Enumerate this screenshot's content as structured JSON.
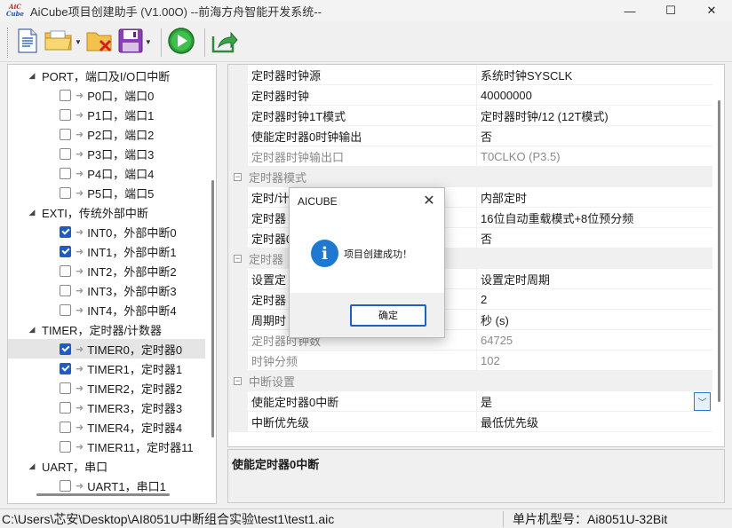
{
  "window": {
    "logo_top": "AiC",
    "logo_bottom": "Cube",
    "title": "AiCube项目创建助手 (V1.00O) --前海方舟智能开发系统--",
    "minimize_glyph": "—",
    "maximize_glyph": "☐",
    "close_glyph": "✕"
  },
  "toolbar": {
    "icons": [
      "new-document-icon",
      "open-folder-icon",
      "delete-folder-icon",
      "save-icon",
      "run-icon",
      "export-icon"
    ],
    "dropdown_glyph": "▼"
  },
  "tree": {
    "items": [
      {
        "type": "group",
        "label": "PORT，端口及I/O口中断"
      },
      {
        "type": "leaf",
        "label": "P0口，端口0",
        "checked": false
      },
      {
        "type": "leaf",
        "label": "P1口，端口1",
        "checked": false
      },
      {
        "type": "leaf",
        "label": "P2口，端口2",
        "checked": false
      },
      {
        "type": "leaf",
        "label": "P3口，端口3",
        "checked": false
      },
      {
        "type": "leaf",
        "label": "P4口，端口4",
        "checked": false
      },
      {
        "type": "leaf",
        "label": "P5口，端口5",
        "checked": false
      },
      {
        "type": "group",
        "label": "EXTI，传统外部中断"
      },
      {
        "type": "leaf",
        "label": "INT0，外部中断0",
        "checked": true
      },
      {
        "type": "leaf",
        "label": "INT1，外部中断1",
        "checked": true
      },
      {
        "type": "leaf",
        "label": "INT2，外部中断2",
        "checked": false
      },
      {
        "type": "leaf",
        "label": "INT3，外部中断3",
        "checked": false
      },
      {
        "type": "leaf",
        "label": "INT4，外部中断4",
        "checked": false
      },
      {
        "type": "group",
        "label": "TIMER，定时器/计数器"
      },
      {
        "type": "leaf",
        "label": "TIMER0，定时器0",
        "checked": true,
        "selected": true
      },
      {
        "type": "leaf",
        "label": "TIMER1，定时器1",
        "checked": true
      },
      {
        "type": "leaf",
        "label": "TIMER2，定时器2",
        "checked": false
      },
      {
        "type": "leaf",
        "label": "TIMER3，定时器3",
        "checked": false
      },
      {
        "type": "leaf",
        "label": "TIMER4，定时器4",
        "checked": false
      },
      {
        "type": "leaf",
        "label": "TIMER11，定时器11",
        "checked": false
      },
      {
        "type": "group",
        "label": "UART，串口"
      },
      {
        "type": "leaf",
        "label": "UART1，串口1",
        "checked": false
      }
    ]
  },
  "properties": {
    "rows": [
      {
        "kind": "prop",
        "name": "定时器时钟源",
        "value": "系统时钟SYSCLK",
        "readonly": false
      },
      {
        "kind": "prop",
        "name": "定时器时钟",
        "value": "40000000",
        "readonly": false
      },
      {
        "kind": "prop",
        "name": "定时器时钟1T模式",
        "value": "定时器时钟/12 (12T模式)",
        "readonly": false
      },
      {
        "kind": "prop",
        "name": "使能定时器0时钟输出",
        "value": "否",
        "readonly": false
      },
      {
        "kind": "prop",
        "name": "定时器时钟输出口",
        "value": "T0CLKO (P3.5)",
        "readonly": true
      },
      {
        "kind": "cat",
        "name": "定时器模式"
      },
      {
        "kind": "prop",
        "name": "定时/计",
        "value": "内部定时",
        "readonly": false
      },
      {
        "kind": "prop",
        "name": "定时器",
        "value": "16位自动重载模式+8位预分频",
        "readonly": false
      },
      {
        "kind": "prop",
        "name": "定时器0",
        "value": "否",
        "readonly": false
      },
      {
        "kind": "cat",
        "name": "定时器"
      },
      {
        "kind": "prop",
        "name": "设置定",
        "value": "设置定时周期",
        "readonly": false
      },
      {
        "kind": "prop",
        "name": "定时器",
        "value": "2",
        "readonly": false
      },
      {
        "kind": "prop",
        "name": "周期时",
        "value": "秒 (s)",
        "readonly": false
      },
      {
        "kind": "prop",
        "name": "定时器时钟数",
        "value": "64725",
        "readonly": true
      },
      {
        "kind": "prop",
        "name": "时钟分频",
        "value": "102",
        "readonly": true
      },
      {
        "kind": "cat",
        "name": "中断设置"
      },
      {
        "kind": "prop",
        "name": "使能定时器0中断",
        "value": "是",
        "readonly": false,
        "dropdown": true
      },
      {
        "kind": "prop",
        "name": "中断优先级",
        "value": "最低优先级",
        "readonly": false
      }
    ],
    "dropdown_glyph": "﹀",
    "collapse_glyph": "−"
  },
  "description": {
    "text": "使能定时器0中断"
  },
  "statusbar": {
    "path": "C:\\Users\\芯安\\Desktop\\AI8051U中断组合实验\\test1\\test1.aic",
    "chip": "单片机型号：Ai8051U-32Bit"
  },
  "dialog": {
    "title": "AICUBE",
    "close_glyph": "✕",
    "icon_glyph": "i",
    "message": "项目创建成功！",
    "ok_label": "确定"
  }
}
